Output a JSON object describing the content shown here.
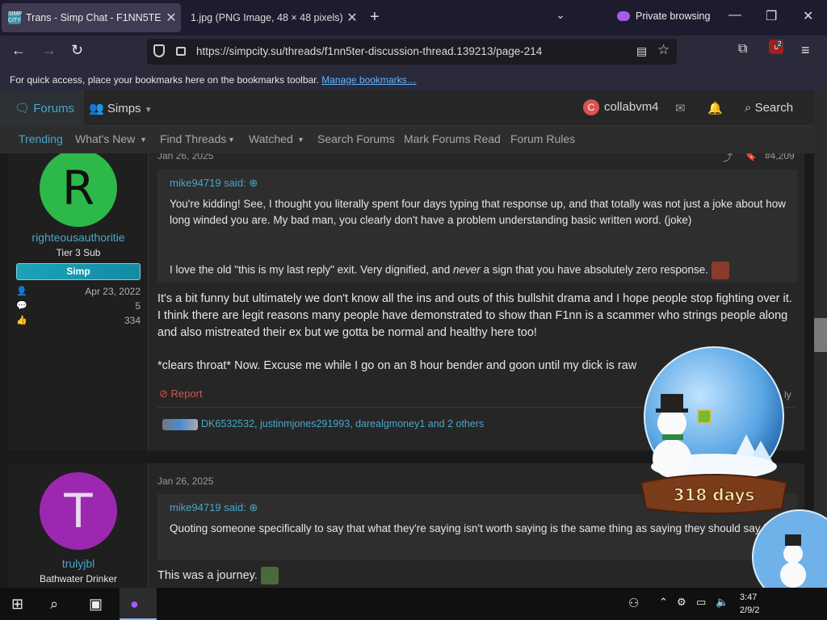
{
  "browser": {
    "tabs": [
      {
        "title": "Trans - Simp Chat - F1NN5TER",
        "favicon_text": "SIMP CITY",
        "active": true
      },
      {
        "title": "1.jpg (PNG Image, 48 × 48 pixels)",
        "active": false
      }
    ],
    "private_label": "Private browsing",
    "url": "https://simpcity.su/threads/f1nn5ter-discussion-thread.139213/page-214",
    "extension_badge_count": "2",
    "bookmarks_text": "For quick access, place your bookmarks here on the bookmarks toolbar.",
    "bookmarks_link": "Manage bookmarks…",
    "icons": {
      "back": "back-arrow-icon",
      "forward": "forward-arrow-icon",
      "reload": "reload-icon"
    }
  },
  "forum_header": {
    "forums": "Forums",
    "simps": "Simps",
    "username": "collabvm4",
    "avatar_letter": "C",
    "search": "Search"
  },
  "subnav": [
    "Trending",
    "What's New",
    "Find Threads",
    "Watched",
    "Search Forums",
    "Mark Forums Read",
    "Forum Rules"
  ],
  "posts": [
    {
      "date": "Jan 26, 2025",
      "number": "#4,209",
      "author": {
        "letter": "R",
        "avatar_color": "#2db84a",
        "name": "righteousauthoritie",
        "title": "Tier 3 Sub",
        "banner": "Simp",
        "joined": "Apr 23, 2022",
        "messages": "5",
        "reactions": "334"
      },
      "quote": {
        "author": "mike94719 said:",
        "p1": "You're kidding! See, I thought you literally spent four days typing that response up, and that totally was not just a joke about how long winded you are. My bad man, you clearly don't have a problem understanding basic written word. (joke)",
        "p2_before": "I love the old \"this is my last reply\" exit. Very dignified, and ",
        "p2_em": "never",
        "p2_after": " a sign that you have absolutely zero response."
      },
      "body_p1": "It's a bit funny but ultimately we don't know all the ins and outs of this bullshit drama and I hope people stop fighting over it. I think there are legit reasons many people have demonstrated to show than F1nn is a scammer who strings people along and also mistreated their ex but we gotta be normal and healthy here too!",
      "body_p2": "*clears throat* Now. Excuse me while I go on an 8 hour bender and goon until my dick is raw",
      "report": "Report",
      "reply": "ly",
      "likes": "DK6532532, justinmjones291993, darealgmoney1 and 2 others"
    },
    {
      "date": "Jan 26, 2025",
      "author": {
        "letter": "T",
        "avatar_color": "#9c27b0",
        "name": "trulyjbl",
        "title": "Bathwater Drinker"
      },
      "quote": {
        "author": "mike94719 said:",
        "p1": "Quoting someone specifically to say that what they're saying isn't worth saying is the same thing as saying they should say it."
      },
      "body_p1": "This was a journey."
    }
  ],
  "globe": {
    "days_label": "318 days",
    "colors": {
      "glass": "#6fb2ea",
      "base": "#7a3b1a"
    }
  },
  "taskbar": {
    "time": "3:47",
    "date": "2/9/2"
  }
}
